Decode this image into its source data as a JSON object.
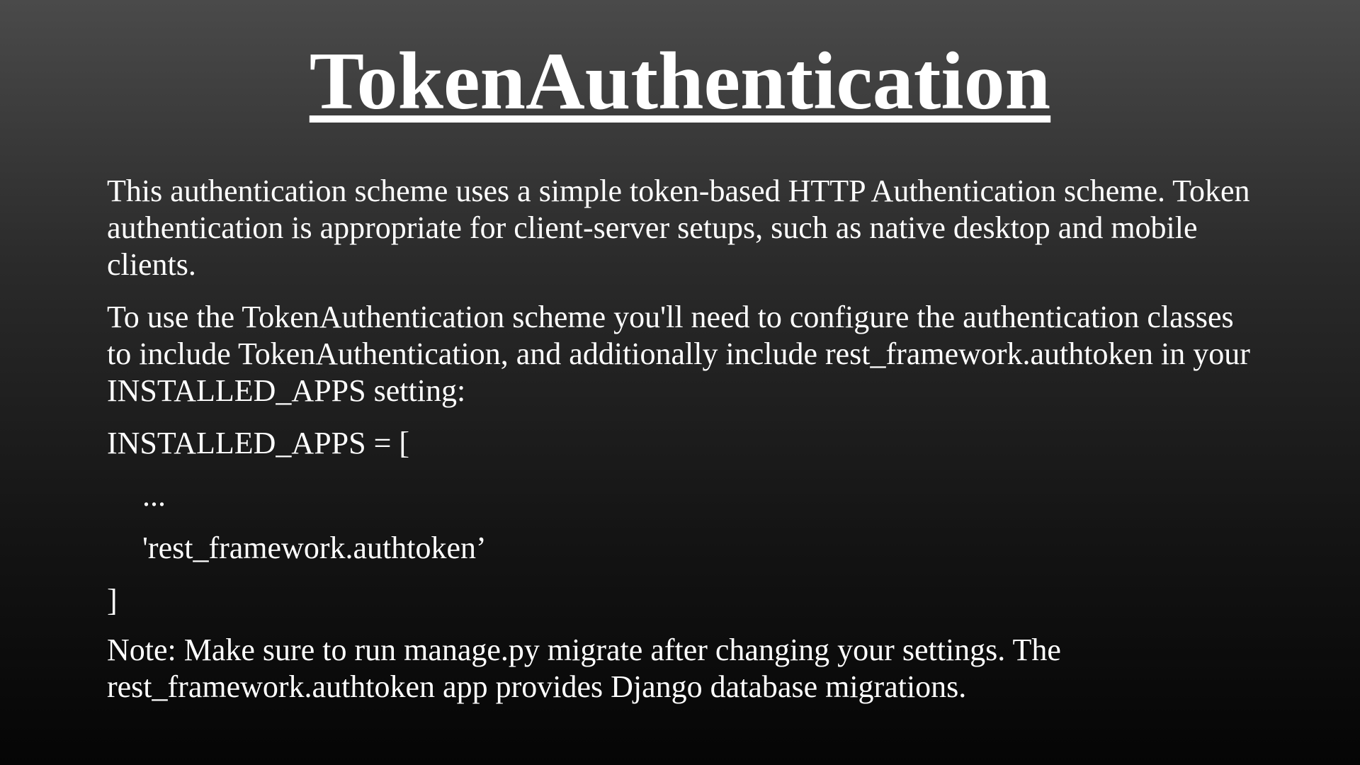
{
  "slide": {
    "title": "TokenAuthentication",
    "paragraph1": "This authentication scheme uses a simple token-based HTTP Authentication scheme. Token authentication is appropriate for client-server setups, such as native desktop and mobile clients.",
    "paragraph2": "To use the TokenAuthentication scheme you'll need to configure the authentication classes to include TokenAuthentication, and additionally include rest_framework.authtoken in your INSTALLED_APPS setting:",
    "code": {
      "line1": "INSTALLED_APPS = [",
      "line2": "...",
      "line3": "'rest_framework.authtoken’",
      "line4": "]"
    },
    "note": "Note: Make sure to run manage.py migrate after changing your settings. The rest_framework.authtoken app provides Django database migrations."
  }
}
